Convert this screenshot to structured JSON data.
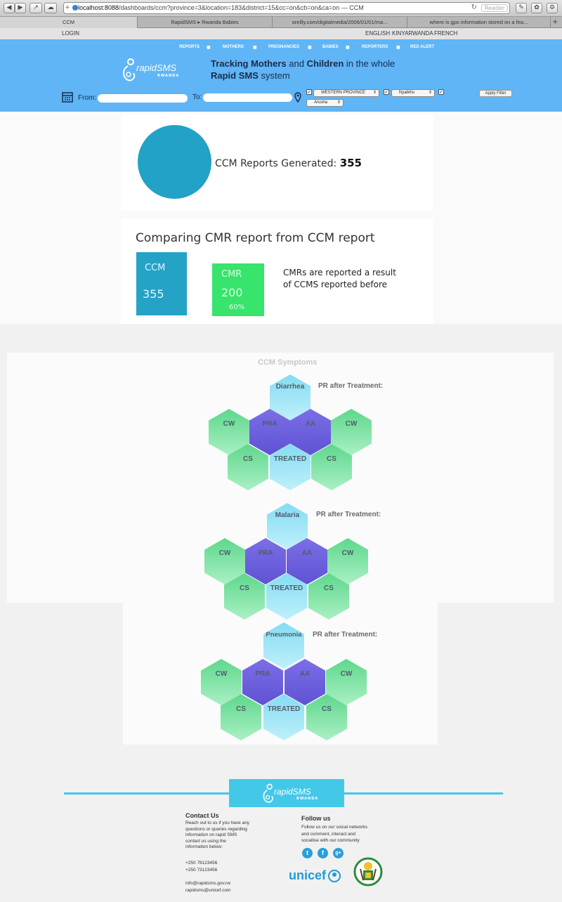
{
  "browser": {
    "url_host": "localhost:8088",
    "url_path": "/dashboards/ccm?province=3&location=183&district=15&cc=on&cb=on&ca=on — CCM",
    "reader_label": "Reader",
    "tabs": [
      "CCM",
      "RapidSMS ▸ Rwanda Babies",
      "oreilly.com/digitalmedia/2006/01/01/ma...",
      "where is gps information stored on a fea..."
    ]
  },
  "topline": {
    "login": "LOGIN",
    "languages": [
      "ENGLISH",
      "KINYARWANDA",
      "FRENCH"
    ]
  },
  "header": {
    "nav": [
      "REPORTS",
      "MOTHERS",
      "PREGNANCIES",
      "BABIES",
      "REPORTERS",
      "RED ALERT"
    ],
    "nav_separator": "■",
    "logo_text": "rapidSMS",
    "logo_sub": "RWANDA",
    "tagline_bold1": "Tracking Mothers",
    "tagline_mid": " and ",
    "tagline_bold2": "Children",
    "tagline_rest": " in the whole",
    "tagline_bold3": "Rapid SMS",
    "tagline_end": " system"
  },
  "filters": {
    "from_label": "From:",
    "to_label": "To:",
    "province": "WESTERN PROVINCE",
    "district": "Nyabihu",
    "location": "Arusha",
    "apply_label": "Apply Filter",
    "check_mark": "✓"
  },
  "summary": {
    "label": "CCM Reports Generated:",
    "value": "355",
    "circle_color": "#22a2c6"
  },
  "compare": {
    "title": "Comparing CMR report from CCM report",
    "ccm_label": "CCM",
    "ccm_value": "355",
    "cmr_label": "CMR",
    "cmr_value": "200",
    "cmr_percent": "60%",
    "note": "CMRs are reported a result of CCMS reported before",
    "ccm_color": "#24a3c7",
    "cmr_color": "#37e46c"
  },
  "symptoms": {
    "title": "CCM Symptoms",
    "pr_label": "PR after Treatment:",
    "groups": [
      "Diarrhea",
      "Malaria",
      "Pneumonia"
    ],
    "hex_labels": {
      "cw": "CW",
      "pra": "PRA",
      "aa": "AA",
      "cs": "CS",
      "treated": "TREATED"
    }
  },
  "footer": {
    "logo_text": "rapidSMS",
    "logo_sub": "RWANDA",
    "contact_title": "Contact Us",
    "contact_text": [
      "Reach out to us if you have any",
      "questions or queries regarding",
      "information on rapid SMS",
      "contact us using the",
      "information below:"
    ],
    "phones": [
      "+250 78123456",
      "+250 73123456"
    ],
    "emails": [
      "info@rapidsms.gov.rw",
      "rapidsms@unicef.com"
    ],
    "follow_title": "Follow us",
    "follow_text": [
      "Follow us on our soical networks",
      "and comment, interact and",
      "socailise with our community"
    ],
    "social": [
      "t",
      "f",
      "g+"
    ],
    "unicef": "unicef"
  }
}
